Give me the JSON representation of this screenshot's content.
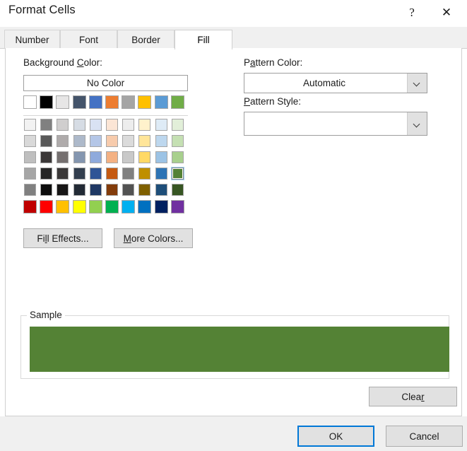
{
  "window": {
    "title": "Format Cells",
    "help_icon": "question-mark-icon",
    "close_icon": "close-x-icon"
  },
  "tabs": [
    {
      "label": "Number",
      "active": false
    },
    {
      "label": "Font",
      "active": false
    },
    {
      "label": "Border",
      "active": false
    },
    {
      "label": "Fill",
      "active": true
    }
  ],
  "fill_tab": {
    "background_color": {
      "label_prefix": "Background ",
      "label_accel": "C",
      "label_suffix": "olor:",
      "no_color_label": "No Color",
      "theme_colors": [
        "#FFFFFF",
        "#000000",
        "#E7E6E6",
        "#44546A",
        "#4472C4",
        "#ED7D31",
        "#A5A5A5",
        "#FFC000",
        "#5B9BD5",
        "#70AD47"
      ],
      "grid_rows": [
        [
          "#F2F2F2",
          "#808080",
          "#D0CECE",
          "#D6DCE4",
          "#D9E2F3",
          "#FBE5D5",
          "#EDEDED",
          "#FFF2CC",
          "#DEEBF6",
          "#E2EFD9"
        ],
        [
          "#D9D9D9",
          "#595959",
          "#AFABAB",
          "#ADB9CA",
          "#B4C6E7",
          "#F7CBAC",
          "#DBDBDB",
          "#FFE599",
          "#BDD7EE",
          "#C5E0B3"
        ],
        [
          "#BFBFBF",
          "#3B3838",
          "#757070",
          "#8496B0",
          "#8FAADC",
          "#F4B183",
          "#C9C9C9",
          "#FFD965",
          "#9CC3E5",
          "#A8D08D"
        ],
        [
          "#A6A6A6",
          "#262626",
          "#3A3838",
          "#333F4F",
          "#2F5496",
          "#C55A11",
          "#808080",
          "#BF8F00",
          "#2E74B5",
          "#538135"
        ],
        [
          "#808080",
          "#0D0D0D",
          "#171616",
          "#222A35",
          "#1F3864",
          "#833C0B",
          "#525252",
          "#7F6000",
          "#1E4E79",
          "#375623"
        ]
      ],
      "selected_cell": {
        "row": 3,
        "col": 9
      },
      "standard_colors": [
        "#C00000",
        "#FF0000",
        "#FFC000",
        "#FFFF00",
        "#92D050",
        "#00B050",
        "#00B0F0",
        "#0070C0",
        "#002060",
        "#7030A0"
      ]
    },
    "fill_effects_button": {
      "label_prefix": "Fi",
      "label_accel": "l",
      "label_suffix": "l Effects..."
    },
    "more_colors_button": {
      "label_accel": "M",
      "label_suffix": "ore Colors..."
    },
    "pattern_color": {
      "label_prefix": "P",
      "label_accel": "a",
      "label_suffix": "ttern Color:",
      "value": "Automatic",
      "arrow_icon": "chevron-down-icon"
    },
    "pattern_style": {
      "label_accel": "P",
      "label_suffix": "attern Style:",
      "value": "",
      "arrow_icon": "chevron-down-icon"
    },
    "sample": {
      "title": "Sample",
      "fill_color": "#548235"
    },
    "clear_button": {
      "label_prefix": "Clea",
      "label_accel": "r",
      "label_suffix": ""
    }
  },
  "footer": {
    "ok_label": "OK",
    "cancel_label": "Cancel"
  },
  "theme": {
    "accent": "#0078D7",
    "dialog_bg": "#FFFFFF",
    "footer_bg": "#F0F0F0",
    "button_bg": "#E1E1E1",
    "selection_highlight": "#CCE4F7"
  }
}
